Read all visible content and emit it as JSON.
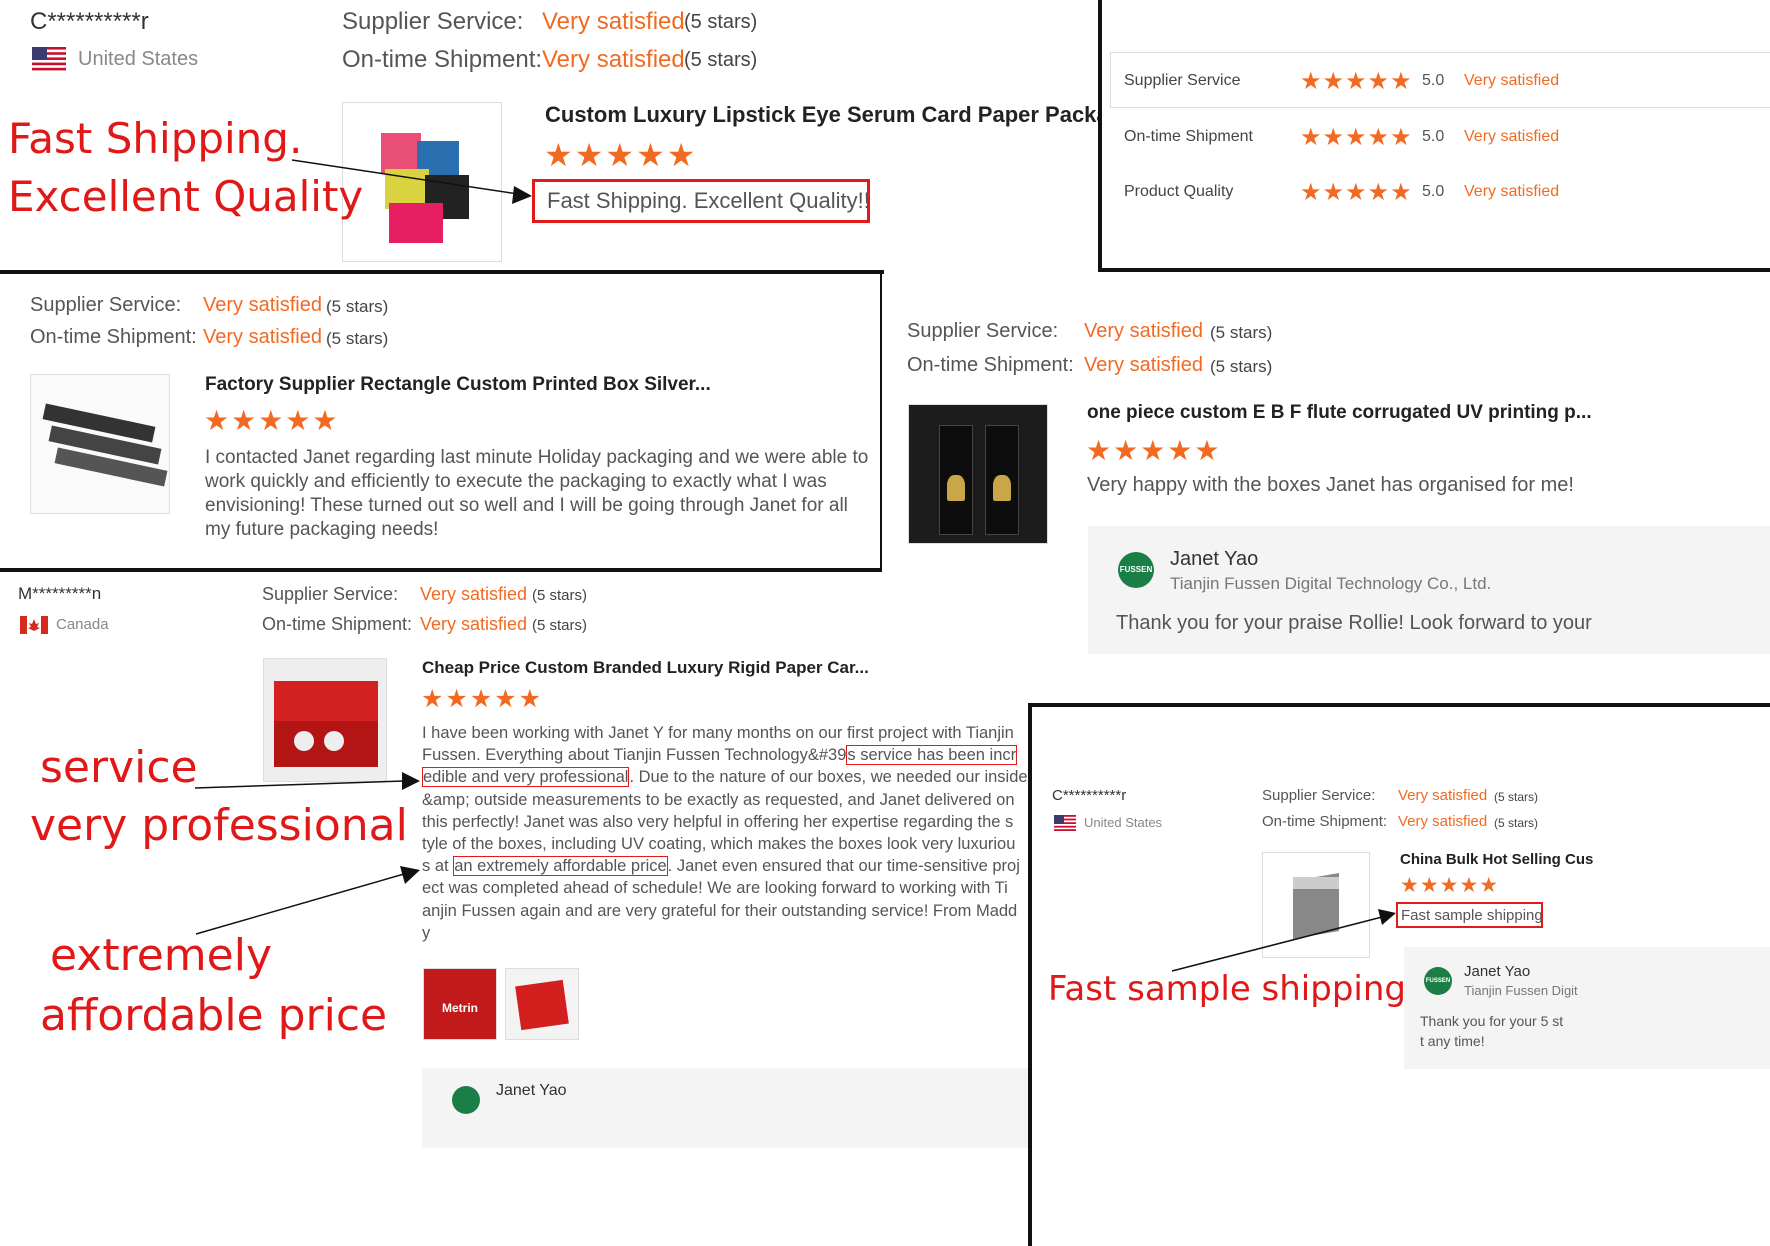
{
  "p1": {
    "user": "C**********r",
    "country": "United States",
    "supplier_label": "Supplier Service:",
    "shipment_label": "On-time Shipment:",
    "supplier_value": "Very satisfied",
    "shipment_value": "Very satisfied",
    "stars_text": "(5 stars)",
    "product_title": "Custom Luxury Lipstick Eye Serum Card Paper Packa...",
    "stars": "★★★★★",
    "review": "Fast Shipping. Excellent Quality!!",
    "annot_line1": "Fast Shipping.",
    "annot_line2": "Excellent Quality"
  },
  "p2": {
    "rows": [
      {
        "label": "Supplier Service",
        "stars": "★★★★★",
        "score": "5.0",
        "value": "Very satisfied"
      },
      {
        "label": "On-time Shipment",
        "stars": "★★★★★",
        "score": "5.0",
        "value": "Very satisfied"
      },
      {
        "label": "Product Quality",
        "stars": "★★★★★",
        "score": "5.0",
        "value": "Very satisfied"
      }
    ]
  },
  "p3": {
    "supplier_label": "Supplier Service:",
    "shipment_label": "On-time Shipment:",
    "supplier_value": "Very satisfied",
    "shipment_value": "Very satisfied",
    "stars_text": "(5 stars)",
    "product_title": "Factory Supplier Rectangle Custom Printed Box Silver...",
    "stars": "★★★★★",
    "review": "I contacted Janet regarding last minute Holiday packaging and we were able to work quickly and efficiently to execute the packaging to exactly what I was envisioning! These turned out so well and I will be going through Janet for all my future packaging needs!"
  },
  "p4": {
    "supplier_label": "Supplier Service:",
    "shipment_label": "On-time Shipment:",
    "supplier_value": "Very satisfied",
    "shipment_value": "Very satisfied",
    "stars_text": "(5 stars)",
    "product_title": "one piece custom E B F flute corrugated UV printing p...",
    "stars": "★★★★★",
    "review": "Very happy with the boxes Janet has organised for me!",
    "reply_name": "Janet Yao",
    "reply_company": "Tianjin Fussen Digital Technology Co., Ltd.",
    "reply_text": "Thank you for your praise Rollie!  Look forward to your",
    "logo_text": "FUSSEN"
  },
  "p5": {
    "user": "M*********n",
    "country": "Canada",
    "supplier_label": "Supplier Service:",
    "shipment_label": "On-time Shipment:",
    "supplier_value": "Very satisfied",
    "shipment_value": "Very satisfied",
    "stars_text": "(5 stars)",
    "product_title": "Cheap Price Custom Branded Luxury Rigid Paper Car...",
    "stars": "★★★★★",
    "review_lines": [
      "I have been working with Janet Y for many months on our first project with Tianjin",
      "Fussen. Everything about Tianjin Fussen Technology&#39",
      "s service has been incr",
      "edible and very professional",
      ". Due to the nature of our boxes, we needed our inside",
      "&amp; outside measurements to be exactly as requested, and Janet delivered on",
      "this perfectly! Janet was also very helpful in offering her expertise regarding the s",
      "tyle of the boxes, including UV coating, which makes the boxes look very luxuriou",
      "s at ",
      "an extremely affordable price",
      ". Janet even ensured that our time-sensitive proj",
      "ect was completed ahead of schedule! We are looking forward to working with Ti",
      "anjin Fussen again and are very grateful for their outstanding service! From Madd",
      "y"
    ],
    "img_label": "Metrin",
    "reply_name": "Janet Yao",
    "annot_service": "service",
    "annot_professional": "very professional",
    "annot_extremely": "extremely",
    "annot_affordable": "affordable price"
  },
  "p6": {
    "user": "C**********r",
    "country": "United States",
    "supplier_label": "Supplier Service:",
    "shipment_label": "On-time Shipment:",
    "supplier_value": "Very satisfied",
    "shipment_value": "Very satisfied",
    "stars_text": "(5 stars)",
    "product_title": "China Bulk Hot Selling Cus",
    "stars": "★★★★★",
    "review": "Fast sample shipping",
    "reply_name": "Janet Yao",
    "reply_company": "Tianjin Fussen Digit",
    "reply_text_1": "Thank you for your 5 st",
    "reply_text_2": "t any time!",
    "logo_text": "FUSSEN",
    "annot": "Fast sample shipping"
  }
}
